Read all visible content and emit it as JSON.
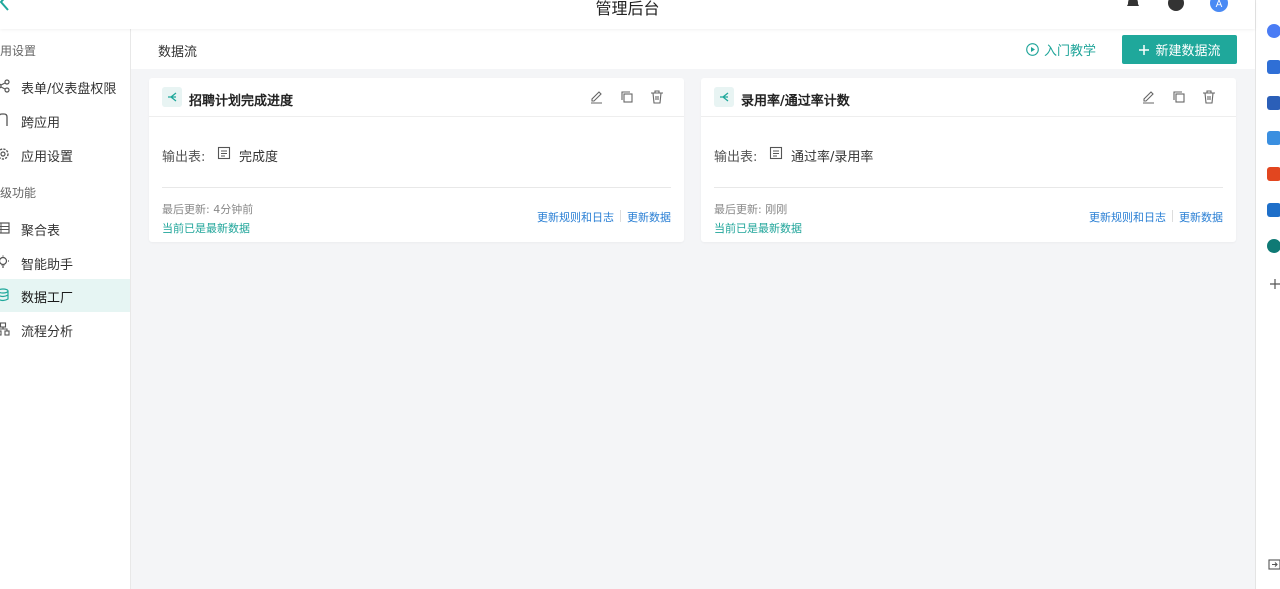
{
  "header": {
    "title": "管理后台"
  },
  "sidebar": {
    "sections": [
      "用设置",
      "级功能"
    ],
    "items": [
      {
        "label": "表单/仪表盘权限",
        "icon": "share-icon"
      },
      {
        "label": "跨应用",
        "icon": "cross-app-icon"
      },
      {
        "label": "应用设置",
        "icon": "gear-icon"
      },
      {
        "label": "聚合表",
        "icon": "table-icon"
      },
      {
        "label": "智能助手",
        "icon": "lightbulb-icon"
      },
      {
        "label": "数据工厂",
        "icon": "database-icon"
      },
      {
        "label": "流程分析",
        "icon": "flow-icon"
      }
    ],
    "active_index": 5
  },
  "main": {
    "breadcrumb": "数据流",
    "tutorial_label": "入门教学",
    "new_button_label": "新建数据流",
    "cards": [
      {
        "title": "招聘计划完成进度",
        "output_label": "输出表:",
        "output_table": "完成度",
        "last_update": "最后更新: 4分钟前",
        "status": "当前已是最新数据",
        "link_rules": "更新规则和日志",
        "link_update": "更新数据"
      },
      {
        "title": "录用率/通过率计数",
        "output_label": "输出表:",
        "output_table": "通过率/录用率",
        "last_update": "最后更新: 刚刚",
        "status": "当前已是最新数据",
        "link_rules": "更新规则和日志",
        "link_update": "更新数据"
      }
    ]
  },
  "colors": {
    "accent": "#1fa89b",
    "link": "#2a7fd4",
    "active_bg": "#e6f5f3"
  }
}
